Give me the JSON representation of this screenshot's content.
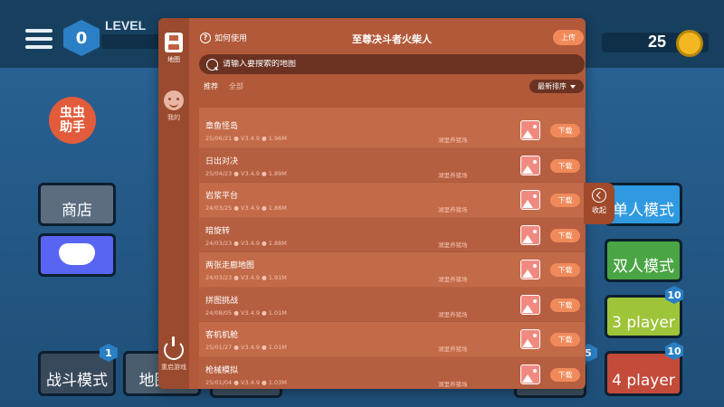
{
  "background": {
    "level_label": "LEVEL",
    "level_value": "0",
    "coins": "25",
    "logo_text": "虫虫\n助手",
    "buttons": {
      "shop": "商店",
      "battle": "战斗模式",
      "map": "地图编",
      "single": "单人模式",
      "double": "双人模式",
      "three_player": "3 player",
      "four_player": "4 player"
    },
    "badges": [
      "1",
      "10",
      "10",
      "5"
    ]
  },
  "sidebar": {
    "items": [
      {
        "label": "地图",
        "icon": "save-icon"
      },
      {
        "label": "我的",
        "icon": "face-icon"
      },
      {
        "label": "重启游戏",
        "icon": "power-icon"
      }
    ]
  },
  "header": {
    "howto": "如何使用",
    "title": "至尊决斗者火柴人",
    "upload": "上传"
  },
  "search": {
    "placeholder": "请输入要搜索的地图"
  },
  "filters": {
    "recommended": "推荐",
    "all": "全部",
    "sort": "最新排序"
  },
  "maps": [
    {
      "name": "章鱼怪岛",
      "meta": "25/06/21 ● V3.4.9 ● 1.96M",
      "author": "湖里养猪场",
      "action": "下载"
    },
    {
      "name": "日出对决",
      "meta": "25/04/23 ● V3.4.9 ● 1.89M",
      "author": "湖里养猪场",
      "action": "下载"
    },
    {
      "name": "岩浆平台",
      "meta": "24/03/25 ● V3.4.9 ● 1.88M",
      "author": "湖里养猪场",
      "action": "下载"
    },
    {
      "name": "暗旋转",
      "meta": "24/03/23 ● V3.4.9 ● 1.88M",
      "author": "湖里养猪场",
      "action": "下载"
    },
    {
      "name": "两张走廊地图",
      "meta": "24/03/23 ● V3.4.9 ● 1.91M",
      "author": "湖里养猪场",
      "action": "下载"
    },
    {
      "name": "拼图挑战",
      "meta": "24/08/05 ● V3.4.9 ● 1.01M",
      "author": "湖里养猪场",
      "action": "下载"
    },
    {
      "name": "客机机舱",
      "meta": "25/01/27 ● V3.4.9 ● 1.01M",
      "author": "湖里养猪场",
      "action": "下载"
    },
    {
      "name": "枪械模拟",
      "meta": "25/01/04 ● V3.4.9 ● 1.03M",
      "author": "湖里养猪场",
      "action": "下载"
    }
  ],
  "collapse_label": "收起",
  "colors": {
    "modal": "#b2593a",
    "accent": "#f08a5a",
    "sidebar": "#9a4a2e"
  }
}
